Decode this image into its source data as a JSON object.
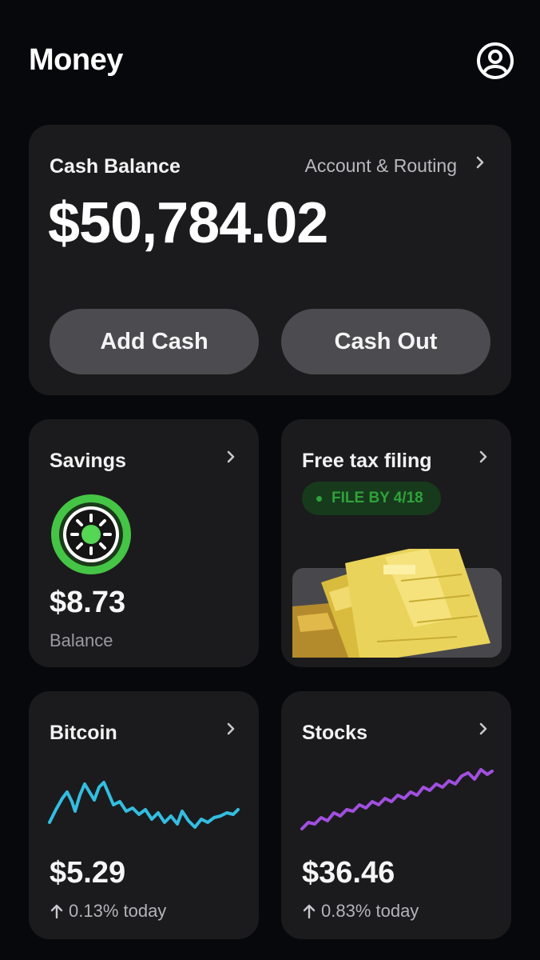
{
  "header": {
    "title": "Money",
    "profile_icon": "profile-icon"
  },
  "cash_balance": {
    "title": "Cash Balance",
    "account_link": "Account & Routing",
    "amount": "$50,784.02",
    "add_cash_label": "Add Cash",
    "cash_out_label": "Cash Out"
  },
  "savings": {
    "title": "Savings",
    "amount": "$8.73",
    "sub_label": "Balance",
    "icon": "savings-sun-icon"
  },
  "tax": {
    "title": "Free tax filing",
    "badge": "FILE BY 4/18",
    "illustration": "tax-documents-illustration"
  },
  "bitcoin": {
    "title": "Bitcoin",
    "amount": "$5.29",
    "change": "0.13% today",
    "line_color": "#34bde0"
  },
  "stocks": {
    "title": "Stocks",
    "amount": "$36.46",
    "change": "0.83% today",
    "line_color": "#a24fe0"
  },
  "colors": {
    "background": "#07080c",
    "card": "#1b1b1d",
    "button": "#4b4b50",
    "accent_green": "#2ea23a"
  }
}
